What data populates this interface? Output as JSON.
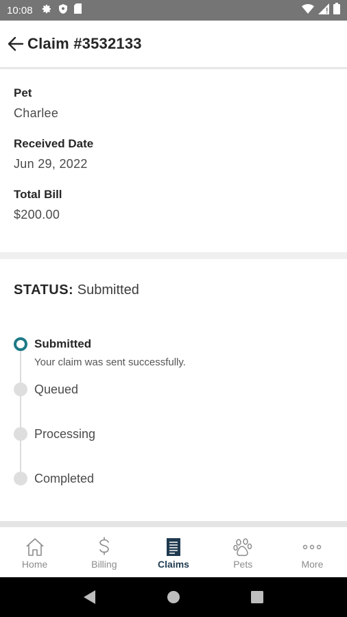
{
  "status_bar": {
    "time": "10:08"
  },
  "header": {
    "title": "Claim #3532133"
  },
  "details": {
    "pet_label": "Pet",
    "pet_value": "Charlee",
    "received_label": "Received Date",
    "received_value": "Jun 29, 2022",
    "total_label": "Total Bill",
    "total_value": "$200.00"
  },
  "status": {
    "key": "STATUS:",
    "value": "Submitted",
    "steps": [
      {
        "title": "Submitted",
        "description": "Your claim was sent successfully.",
        "active": true
      },
      {
        "title": "Queued",
        "active": false
      },
      {
        "title": "Processing",
        "active": false
      },
      {
        "title": "Completed",
        "active": false
      }
    ]
  },
  "bottom_nav": {
    "items": [
      {
        "label": "Home",
        "icon": "home-icon"
      },
      {
        "label": "Billing",
        "icon": "dollar-icon"
      },
      {
        "label": "Claims",
        "icon": "document-icon",
        "active": true
      },
      {
        "label": "Pets",
        "icon": "paw-icon"
      },
      {
        "label": "More",
        "icon": "more-dots-icon"
      }
    ]
  },
  "colors": {
    "accent": "#1d7a86",
    "active_nav": "#1f3a4f",
    "status_bar": "#757575"
  }
}
